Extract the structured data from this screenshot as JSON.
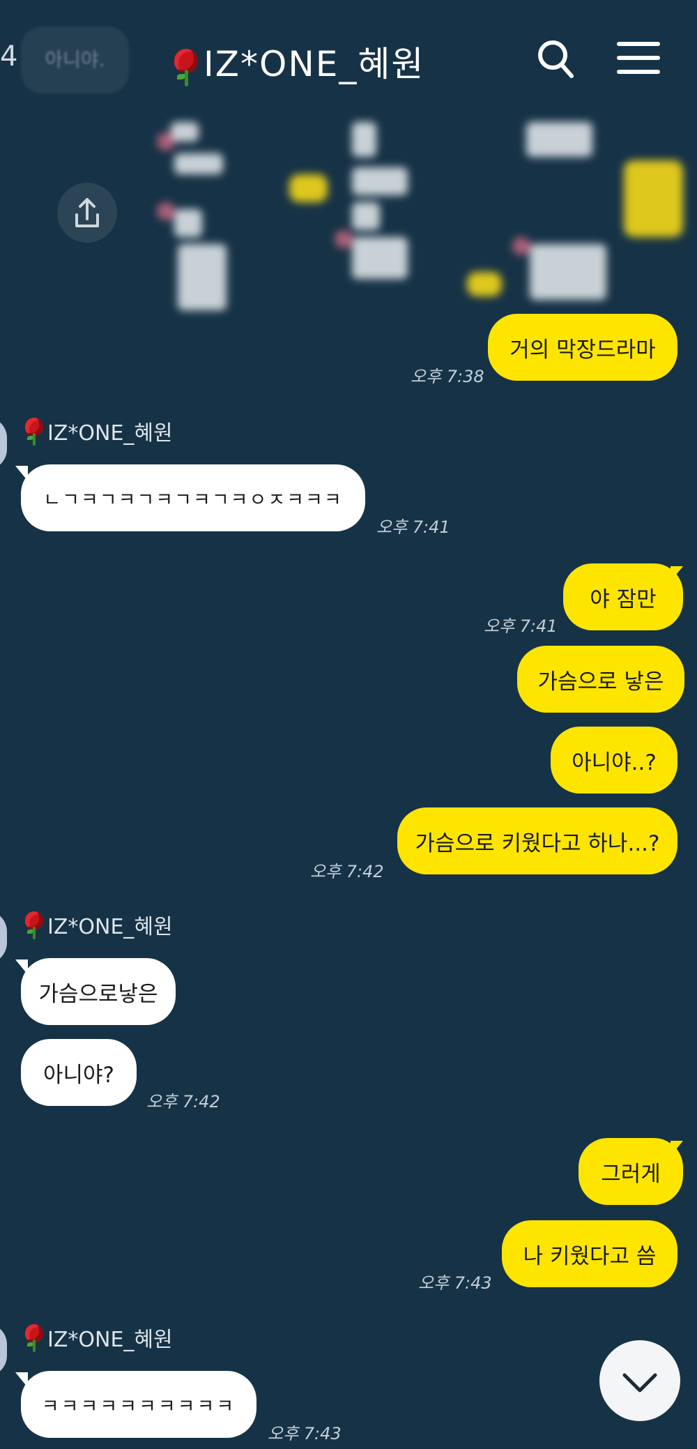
{
  "header": {
    "title": "IZ*ONE_혜원",
    "back_fragment": "4",
    "prev_preview": "아니야.",
    "search_icon": "search-icon",
    "menu_icon": "menu-icon"
  },
  "colors": {
    "background": "#163246",
    "my_bubble": "#fee500",
    "other_bubble": "#ffffff"
  },
  "messages": {
    "m1": {
      "text": "거의 막장드라마",
      "time": "오후 7:38"
    },
    "s1": {
      "sender": "IZ*ONE_혜원"
    },
    "m2": {
      "text": "ㄴㄱㅋㄱㅋㄱㅋㄱㅋㄱㅋㅇㅈㅋㅋㅋ",
      "time": "오후 7:41"
    },
    "m3": {
      "text": "야 잠만",
      "time": "오후 7:41"
    },
    "m4": {
      "text": "가슴으로 낳은"
    },
    "m5": {
      "text": "아니야..?"
    },
    "m6": {
      "text": "가슴으로 키웠다고 하나...?",
      "time": "오후 7:42"
    },
    "s2": {
      "sender": "IZ*ONE_혜원"
    },
    "m7": {
      "text": "가슴으로낳은"
    },
    "m8": {
      "text": "아니야?",
      "time": "오후 7:42"
    },
    "m9": {
      "text": "그러게"
    },
    "m10": {
      "text": "나 키웠다고 씀",
      "time": "오후 7:43"
    },
    "s3": {
      "sender": "IZ*ONE_혜원"
    },
    "m11": {
      "text": "ㅋㅋㅋㅋㅋㅋㅋㅋㅋㅋ",
      "time": "오후 7:43"
    }
  }
}
